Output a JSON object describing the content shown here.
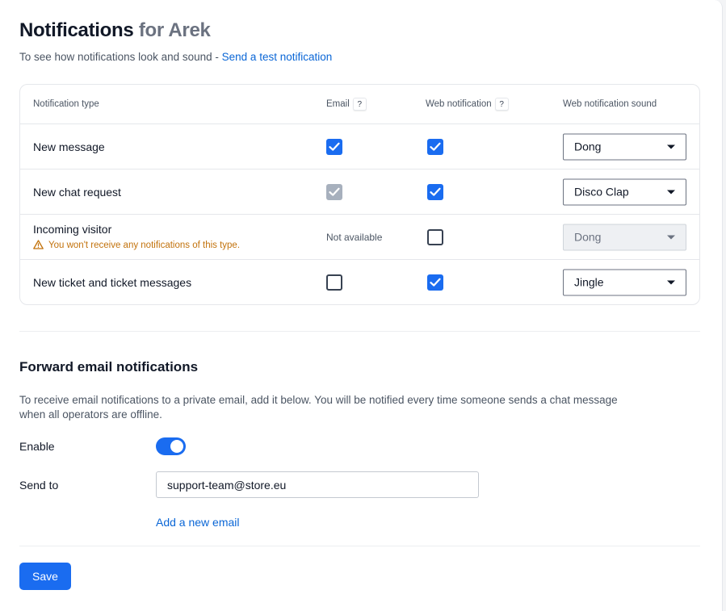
{
  "header": {
    "title": "Notifications",
    "title_suffix": "for Arek",
    "subtitle": "To see how notifications look and sound - ",
    "test_link": "Send a test notification"
  },
  "table": {
    "columns": {
      "type": "Notification type",
      "email": "Email",
      "email_help": "?",
      "web": "Web notification",
      "web_help": "?",
      "sound": "Web notification sound"
    },
    "rows": [
      {
        "name": "New message",
        "email": "checked",
        "web": "checked",
        "sound": "Dong"
      },
      {
        "name": "New chat request",
        "email": "checked-disabled",
        "web": "checked",
        "sound": "Disco Clap"
      },
      {
        "name": "Incoming visitor",
        "email_text": "Not available",
        "warning": "You won't receive any notifications of this type.",
        "web": "unchecked",
        "sound": "Dong",
        "sound_disabled": true
      },
      {
        "name": "New ticket and ticket messages",
        "email": "unchecked",
        "web": "checked",
        "sound": "Jingle"
      }
    ]
  },
  "forward": {
    "title": "Forward email notifications",
    "description": "To receive email notifications to a private email, add it below. You will be notified every time someone sends a chat message when all operators are offline.",
    "enable_label": "Enable",
    "enabled": true,
    "send_to_label": "Send to",
    "send_to_value": "support-team@store.eu",
    "add_email_link": "Add a new email"
  },
  "actions": {
    "save_label": "Save"
  },
  "colors": {
    "accent": "#1a6cf0",
    "link": "#0a66d6",
    "warning": "#c2720c"
  },
  "icons": {
    "check": "check-icon",
    "warning": "warning-triangle-icon",
    "caret": "caret-down-icon"
  }
}
